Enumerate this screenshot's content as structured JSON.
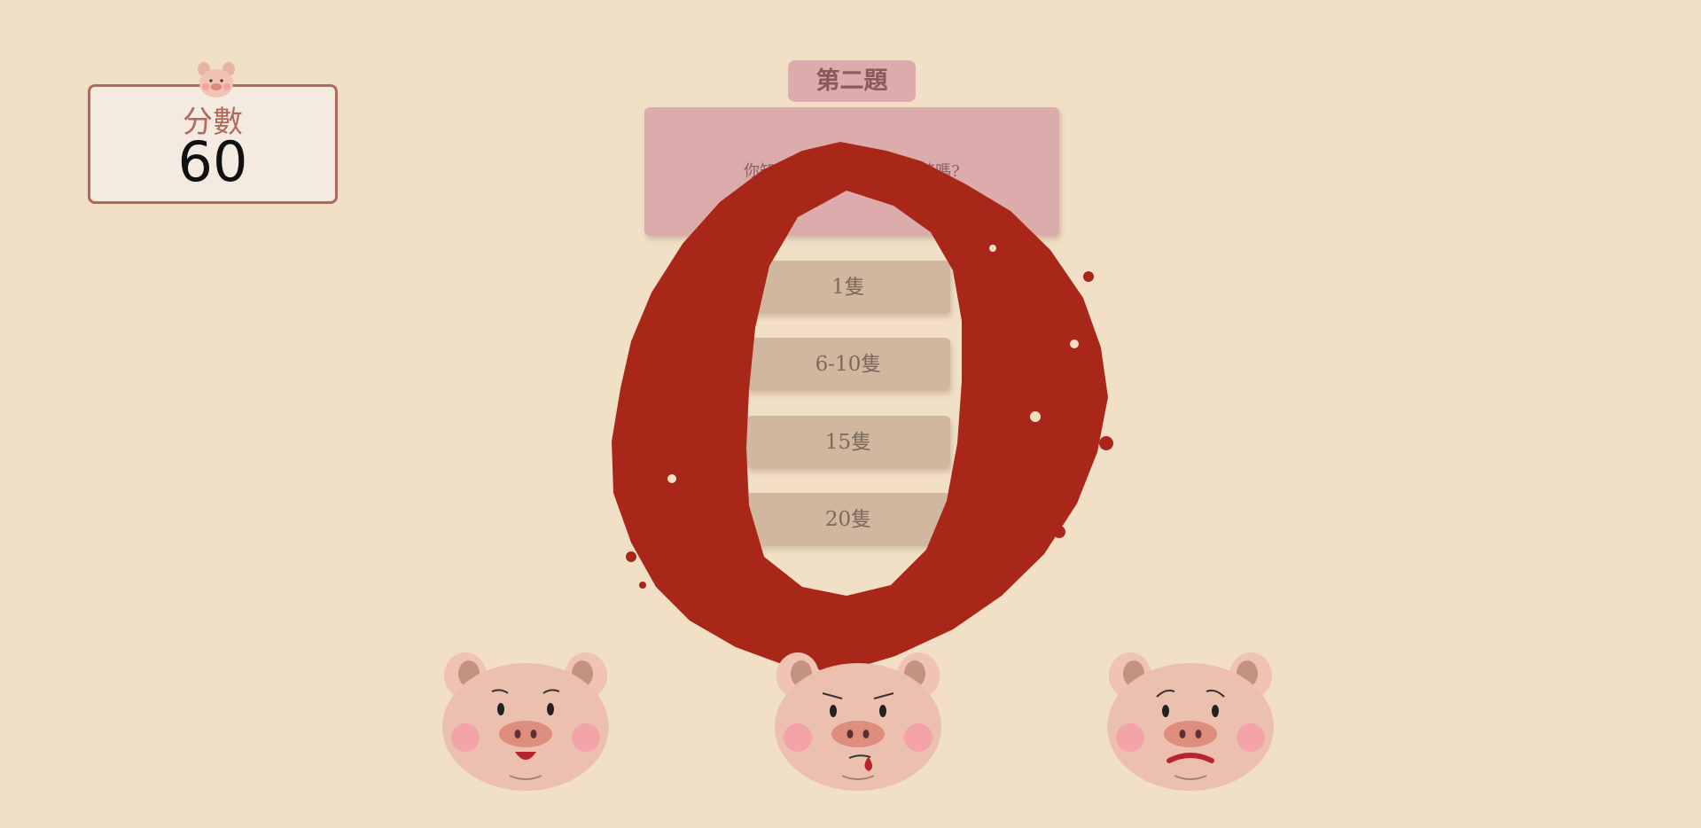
{
  "score": {
    "label": "分數",
    "value": "60",
    "icon": "pig-head-icon"
  },
  "question": {
    "title": "第二題",
    "text": "你知道豬一次能生幾隻小豬嗎?",
    "options": [
      "1隻",
      "6-10隻",
      "15隻",
      "20隻"
    ]
  },
  "pigs": [
    {
      "expression": "happy"
    },
    {
      "expression": "cheeky"
    },
    {
      "expression": "worried"
    }
  ],
  "colors": {
    "background": "#f1dfc6",
    "card_border": "#b0695e",
    "question_bg": "#dcabab",
    "option_bg": "#d1b79e",
    "splat": "#a82718"
  }
}
